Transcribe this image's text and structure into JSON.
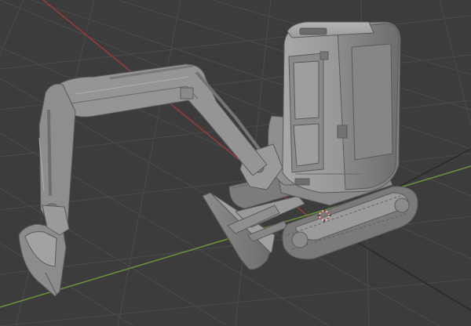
{
  "viewport": {
    "name": "3d-viewport",
    "background": "#3c3c3c",
    "grid_color": "#4a4a4a",
    "x_axis_color": "#a23a3a",
    "y_axis_color": "#6d9a3a"
  },
  "scene": {
    "object": "mini-excavator",
    "shading": "solid",
    "model_color": "#9a9a9a",
    "origin_icon": "3d-cursor-icon"
  }
}
